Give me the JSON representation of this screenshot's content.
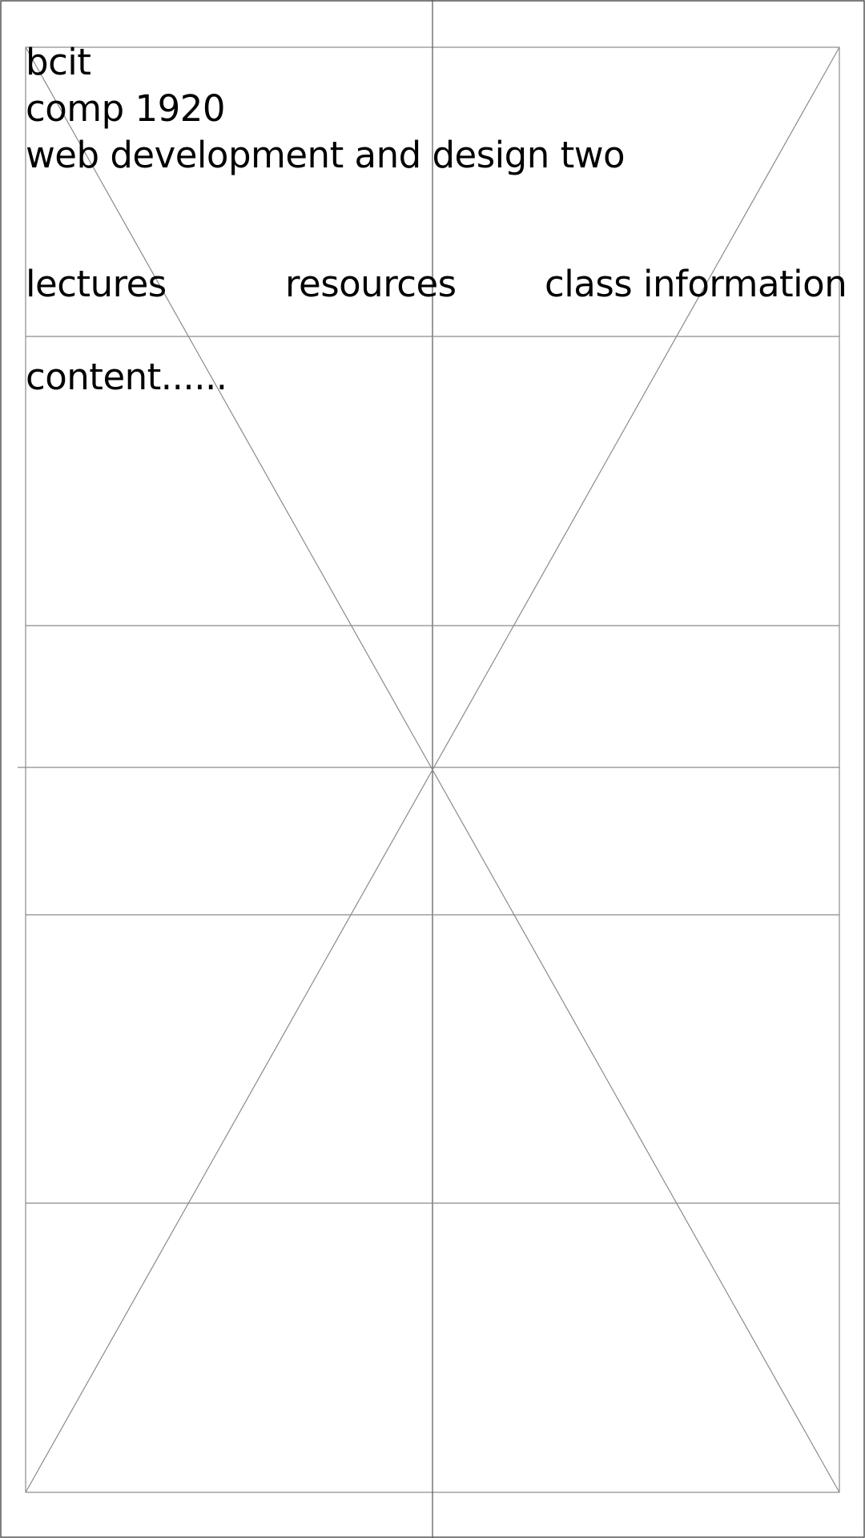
{
  "header": {
    "institution": "bcit",
    "course_code": "comp 1920",
    "course_title": "web development and design two"
  },
  "nav": {
    "items": [
      {
        "label": "lectures"
      },
      {
        "label": "resources"
      },
      {
        "label": "class information"
      }
    ]
  },
  "main": {
    "content": "content......"
  },
  "colors": {
    "lines": "#8a8a8a",
    "frame": "#555555",
    "text": "#000000"
  }
}
